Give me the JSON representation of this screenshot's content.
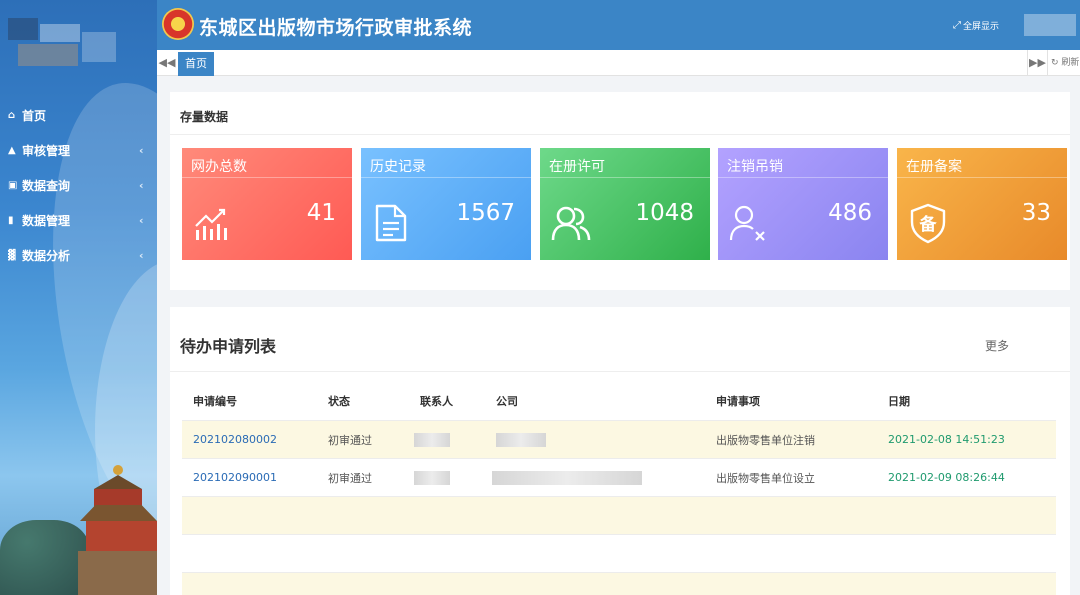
{
  "header": {
    "title": "东城区出版物市场行政审批系统",
    "fullscreen_label": "全屏显示"
  },
  "sidebar": {
    "items": [
      {
        "label": "首页",
        "icon": "home-icon",
        "has_children": false
      },
      {
        "label": "审核管理",
        "icon": "binoculars-icon",
        "has_children": true
      },
      {
        "label": "数据查询",
        "icon": "calendar-icon",
        "has_children": true
      },
      {
        "label": "数据管理",
        "icon": "eraser-icon",
        "has_children": true
      },
      {
        "label": "数据分析",
        "icon": "bar-chart-icon",
        "has_children": true
      }
    ]
  },
  "tabbar": {
    "home_tab": "首页",
    "refresh_label": "刷新"
  },
  "stats": {
    "title": "存量数据",
    "cards": [
      {
        "label": "网办总数",
        "value": "41",
        "icon": "trend-chart-icon",
        "color": "#ff6a5f"
      },
      {
        "label": "历史记录",
        "value": "1567",
        "icon": "document-icon",
        "color": "#58a9f5"
      },
      {
        "label": "在册许可",
        "value": "1048",
        "icon": "users-icon",
        "color": "#3dbb58"
      },
      {
        "label": "注销吊销",
        "value": "486",
        "icon": "user-remove-icon",
        "color": "#9a91f4"
      },
      {
        "label": "在册备案",
        "value": "33",
        "icon": "shield-record-icon",
        "color": "#ee9a34",
        "icon_char": "备"
      }
    ]
  },
  "pending": {
    "title": "待办申请列表",
    "more_label": "更多",
    "columns": [
      "申请编号",
      "状态",
      "联系人",
      "公司",
      "申请事项",
      "日期"
    ],
    "rows": [
      {
        "id": "202102080002",
        "status": "初审通过",
        "item": "出版物零售单位注销",
        "date": "2021-02-08 14:51:23"
      },
      {
        "id": "202102090001",
        "status": "初审通过",
        "item": "出版物零售单位设立",
        "date": "2021-02-09 08:26:44"
      }
    ]
  }
}
